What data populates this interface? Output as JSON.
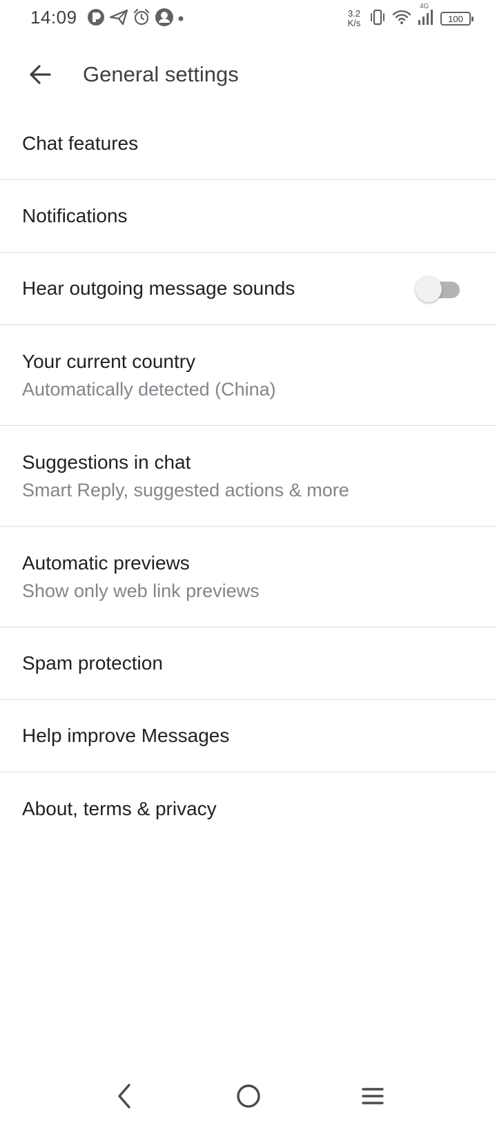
{
  "status_bar": {
    "time": "14:09",
    "net_speed_value": "3.2",
    "net_speed_unit": "K/s",
    "network_type": "4G",
    "battery_level": "100",
    "icons_left": [
      "app-notification-icon",
      "send-icon",
      "alarm-icon",
      "avatar-notification-icon",
      "more-dot-icon"
    ],
    "icons_right": [
      "vibrate-icon",
      "wifi-icon",
      "signal-icon",
      "battery-icon"
    ]
  },
  "app_bar": {
    "title": "General settings",
    "back_icon": "arrow-back-icon"
  },
  "settings": [
    {
      "title": "Chat features"
    },
    {
      "title": "Notifications"
    },
    {
      "title": "Hear outgoing message sounds",
      "toggle_on": false
    },
    {
      "title": "Your current country",
      "subtitle": "Automatically detected (China)"
    },
    {
      "title": "Suggestions in chat",
      "subtitle": "Smart Reply, suggested actions & more"
    },
    {
      "title": "Automatic previews",
      "subtitle": "Show only web link previews"
    },
    {
      "title": "Spam protection"
    },
    {
      "title": "Help improve Messages"
    },
    {
      "title": "About, terms & privacy"
    }
  ],
  "nav_bar": {
    "icons": [
      "nav-back-icon",
      "nav-home-icon",
      "nav-menu-icon"
    ]
  },
  "colors": {
    "primary_text": "#202124",
    "secondary_text": "#80868b",
    "divider": "#dadce0",
    "toggle_off_track": "#b3b3b3",
    "toggle_off_thumb": "#f1f1f1"
  }
}
